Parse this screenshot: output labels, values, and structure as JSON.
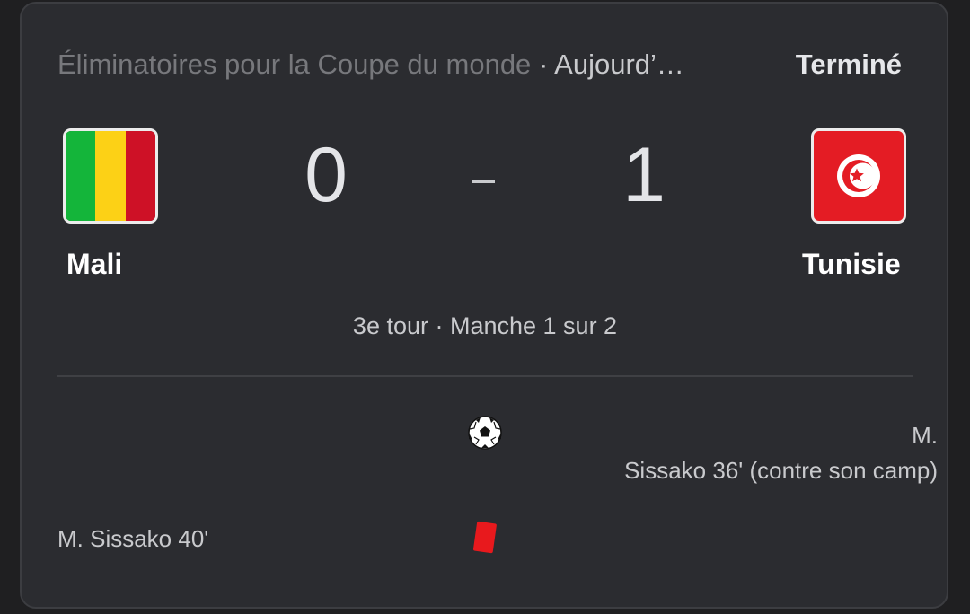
{
  "match": {
    "competition": "Éliminatoires pour la Coupe du monde",
    "date": "· Aujourd’…",
    "status": "Terminé",
    "round": "3e tour · Manche 1 sur 2"
  },
  "home": {
    "name": "Mali",
    "score": "0",
    "flag_icon": "mali-flag-icon",
    "colors": [
      "#14b53a",
      "#fcd116",
      "#ce1126"
    ]
  },
  "away": {
    "name": "Tunisie",
    "score": "1",
    "flag_icon": "tunisia-flag-icon",
    "colors": [
      "#e41c24",
      "#ffffff"
    ]
  },
  "score_separator": "-",
  "events": [
    {
      "type": "goal",
      "icon": "soccer-ball-icon",
      "team": "away",
      "line1": "M.",
      "line2": "Sissako 36' (contre son camp)"
    },
    {
      "type": "red-card",
      "icon": "red-card-icon",
      "team": "home",
      "text": "M. Sissako 40'",
      "color": "#e8191d"
    }
  ]
}
